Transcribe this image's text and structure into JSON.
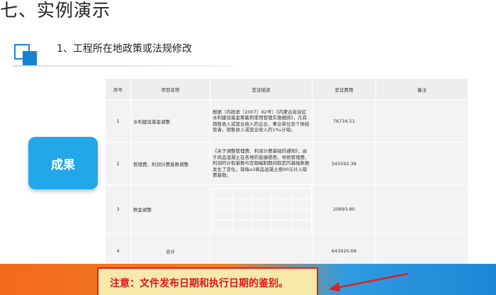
{
  "slide": {
    "title": "七、实例演示",
    "subtitle": "1、工程所在地政策或法规修改",
    "result_label": "成果"
  },
  "table": {
    "headers": [
      "序号",
      "项目名称",
      "签证描述",
      "签证费用",
      "备注"
    ],
    "rows": [
      {
        "no": "1",
        "name": "水利建设基金调整",
        "desc": "根据（内政发〔2007〕92号）《内蒙古自治区水利建设基金筹集和使用管理实施细则》，凡有销售收入或营业收入的企业、事业单位及个体经营者，销售收入或营业收入的1‰计取。",
        "amount": "76734.51",
        "note": ""
      },
      {
        "no": "2",
        "name": "管理费、利润计费基数调整",
        "desc": "《关于调整管理费、利润计费基础的通知》，由于商品混凝土在各地的普遍使用，导致管理费、利润的计取基数与定额编制期间取定的基础数据发生了变化，现每a3商品混凝土按90元计入取费基数。",
        "amount": "545592.38",
        "note": ""
      },
      {
        "no": "3",
        "name": "税金调整",
        "desc": "",
        "amount": "20693.80",
        "note": ""
      },
      {
        "no": "4",
        "name": "合计",
        "desc": "",
        "amount": "643020.69",
        "note": ""
      }
    ]
  },
  "notice": {
    "text": "注意：文件发布日期和执行日期的鉴别。"
  },
  "colors": {
    "accent_blue": "#21a6ea",
    "notice_red": "#e0151a",
    "band_orange": "#f26a1b"
  }
}
